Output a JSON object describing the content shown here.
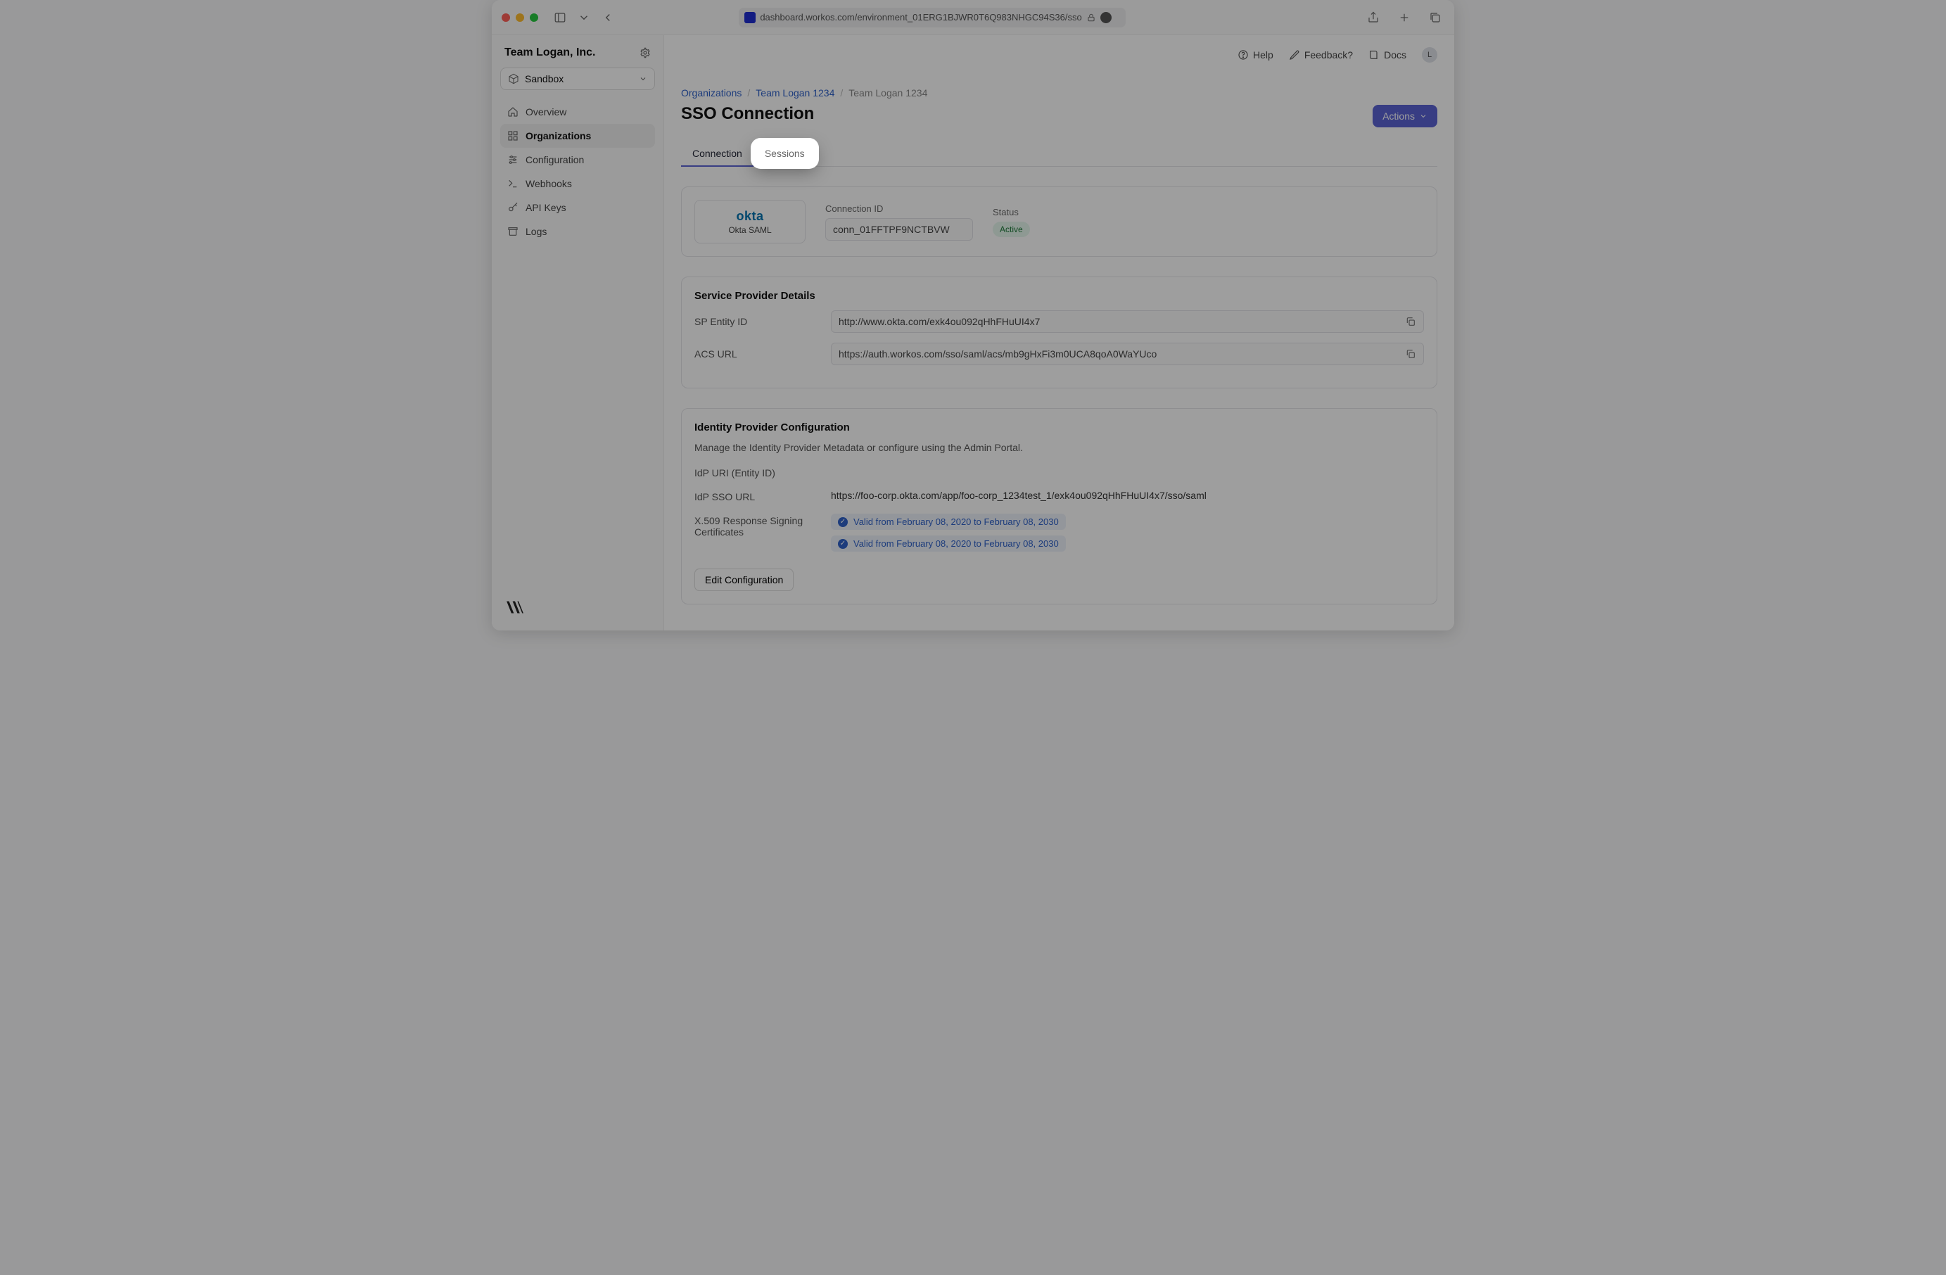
{
  "browser": {
    "url": "dashboard.workos.com/environment_01ERG1BJWR0T6Q983NHGC94S36/sso"
  },
  "sidebar": {
    "team": "Team Logan, Inc.",
    "env": "Sandbox",
    "items": [
      {
        "label": "Overview"
      },
      {
        "label": "Organizations"
      },
      {
        "label": "Configuration"
      },
      {
        "label": "Webhooks"
      },
      {
        "label": "API Keys"
      },
      {
        "label": "Logs"
      }
    ]
  },
  "topbar": {
    "help": "Help",
    "feedback": "Feedback?",
    "docs": "Docs",
    "avatar_initial": "L"
  },
  "breadcrumbs": {
    "org_root": "Organizations",
    "org": "Team Logan 1234",
    "leaf": "Team Logan 1234"
  },
  "page": {
    "title": "SSO Connection",
    "actions_label": "Actions"
  },
  "tabs": {
    "connection": "Connection",
    "sessions": "Sessions"
  },
  "connection": {
    "provider_name": "Okta SAML",
    "provider_logo_text": "okta",
    "id_label": "Connection ID",
    "id_value": "conn_01FFTPF9NCTBVW",
    "status_label": "Status",
    "status_value": "Active"
  },
  "sp": {
    "section_title": "Service Provider Details",
    "entity_label": "SP Entity ID",
    "entity_value": "http://www.okta.com/exk4ou092qHhFHuUI4x7",
    "acs_label": "ACS URL",
    "acs_value": "https://auth.workos.com/sso/saml/acs/mb9gHxFi3m0UCA8qoA0WaYUco"
  },
  "idp": {
    "section_title": "Identity Provider Configuration",
    "section_desc": "Manage the Identity Provider Metadata or configure using the Admin Portal.",
    "uri_label": "IdP URI (Entity ID)",
    "uri_value": "",
    "sso_label": "IdP SSO URL",
    "sso_value": "https://foo-corp.okta.com/app/foo-corp_1234test_1/exk4ou092qHhFHuUI4x7/sso/saml",
    "cert_label": "X.509 Response Signing Certificates",
    "certs": [
      "Valid from February 08, 2020 to February 08, 2030",
      "Valid from February 08, 2020 to February 08, 2030"
    ],
    "edit_label": "Edit Configuration"
  }
}
